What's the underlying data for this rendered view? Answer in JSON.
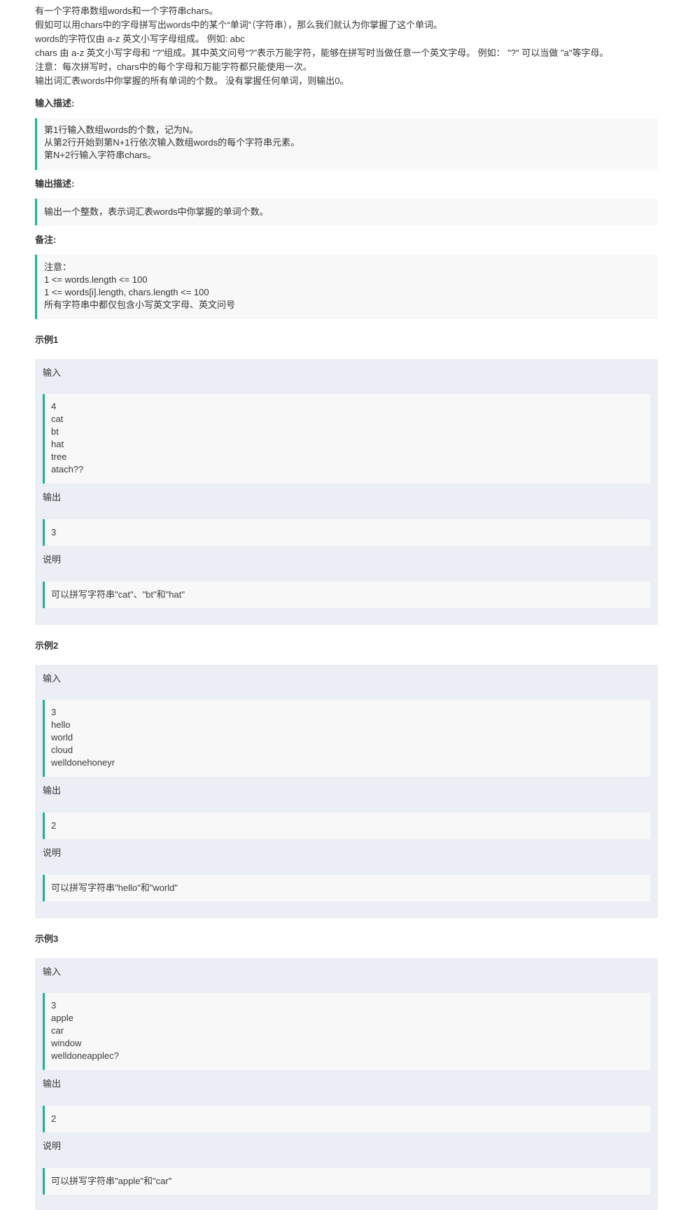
{
  "description": {
    "lines": [
      "有一个字符串数组words和一个字符串chars。",
      "假如可以用chars中的字母拼写出words中的某个“单词”（字符串），那么我们就认为你掌握了这个单词。",
      "words的字符仅由 a-z 英文小写字母组成。 例如: abc",
      "chars 由 a-z 英文小写字母和 “?”组成。其中英文问号“?”表示万能字符，能够在拼写时当做任意一个英文字母。 例如： \"?\" 可以当做 \"a\"等字母。",
      "注意：每次拼写时，chars中的每个字母和万能字符都只能使用一次。",
      "输出词汇表words中你掌握的所有单词的个数。 没有掌握任何单词，则输出0。"
    ]
  },
  "input_desc": {
    "title": "输入描述:",
    "lines": [
      "第1行输入数组words的个数，记为N。",
      "从第2行开始到第N+1行依次输入数组words的每个字符串元素。",
      "第N+2行输入字符串chars。"
    ]
  },
  "output_desc": {
    "title": "输出描述:",
    "lines": [
      "输出一个整数，表示词汇表words中你掌握的单词个数。"
    ]
  },
  "notes": {
    "title": "备注:",
    "lines": [
      "注意：",
      "1 <= words.length <= 100",
      "1 <= words[i].length, chars.length <= 100",
      "所有字符串中都仅包含小写英文字母、英文问号"
    ]
  },
  "labels": {
    "input": "输入",
    "output": "输出",
    "explain": "说明"
  },
  "examples": [
    {
      "title": "示例1",
      "input": [
        "4",
        "cat",
        "bt",
        "hat",
        "tree",
        "atach??"
      ],
      "output": [
        "3"
      ],
      "explain": [
        "可以拼写字符串\"cat\"、\"bt\"和\"hat\""
      ]
    },
    {
      "title": "示例2",
      "input": [
        "3",
        "hello",
        "world",
        "cloud",
        "welldonehoneyr"
      ],
      "output": [
        "2"
      ],
      "explain": [
        "可以拼写字符串\"hello\"和\"world\""
      ]
    },
    {
      "title": "示例3",
      "input": [
        "3",
        "apple",
        "car",
        "window",
        "welldoneapplec?"
      ],
      "output": [
        "2"
      ],
      "explain": [
        "可以拼写字符串\"apple\"和\"car\""
      ]
    }
  ],
  "colors": {
    "accent": "#1ab394",
    "quote_bg": "#f8f8f8",
    "example_bg": "#ebeff5"
  }
}
